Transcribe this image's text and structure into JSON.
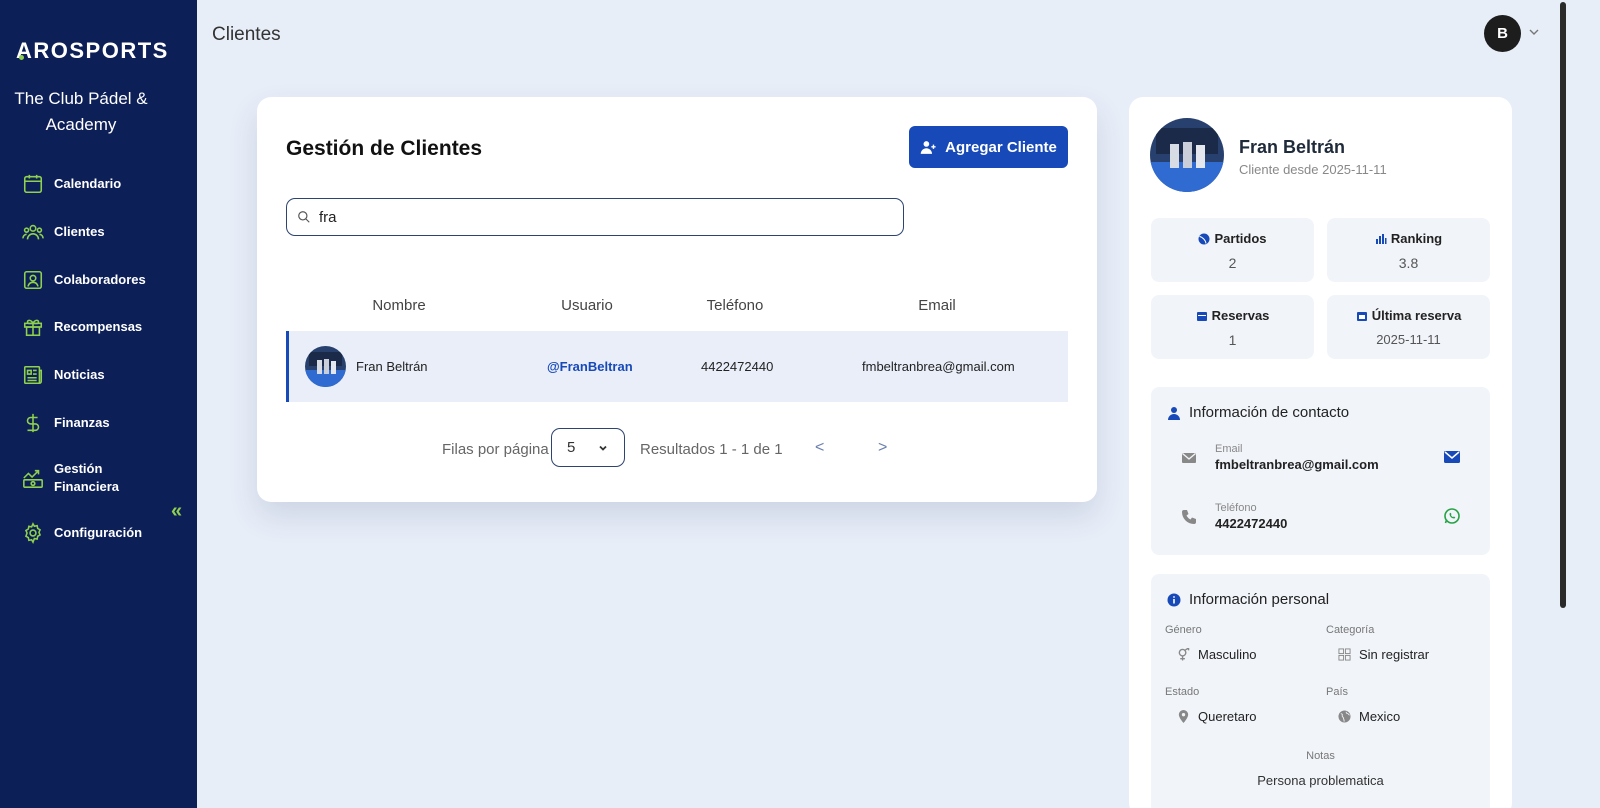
{
  "app": {
    "logo": "AROSPORTS",
    "club_name": "The Club Pádel & Academy"
  },
  "sidebar": {
    "items": [
      {
        "label": "Calendario",
        "icon": "calendar-icon"
      },
      {
        "label": "Clientes",
        "icon": "users-icon"
      },
      {
        "label": "Colaboradores",
        "icon": "id-badge-icon"
      },
      {
        "label": "Recompensas",
        "icon": "gift-icon"
      },
      {
        "label": "Noticias",
        "icon": "newspaper-icon"
      },
      {
        "label": "Finanzas",
        "icon": "dollar-icon"
      },
      {
        "label": "Gestión Financiera",
        "icon": "finance-chart-icon"
      },
      {
        "label": "Configuración",
        "icon": "gear-icon"
      }
    ],
    "collapse_glyph": "«"
  },
  "header": {
    "title": "Clientes",
    "avatar_initial": "B"
  },
  "clients": {
    "title": "Gestión de Clientes",
    "add_button": "Agregar Cliente",
    "search_value": "fra",
    "columns": [
      "Nombre",
      "Usuario",
      "Teléfono",
      "Email"
    ],
    "rows": [
      {
        "name": "Fran Beltrán",
        "username": "@FranBeltran",
        "phone": "4422472440",
        "email": "fmbeltranbrea@gmail.com"
      }
    ],
    "pagination": {
      "rows_label": "Filas por página",
      "rows_value": "5",
      "results": "Resultados 1 - 1 de 1",
      "prev": "<",
      "next": ">"
    }
  },
  "profile": {
    "name": "Fran Beltrán",
    "since": "Cliente desde 2025-11-11",
    "stats": [
      {
        "label": "Partidos",
        "value": "2"
      },
      {
        "label": "Ranking",
        "value": "3.8"
      },
      {
        "label": "Reservas",
        "value": "1"
      },
      {
        "label": "Última reserva",
        "value": "2025-11-11"
      }
    ],
    "contact": {
      "title": "Información de contacto",
      "email_label": "Email",
      "email": "fmbeltranbrea@gmail.com",
      "phone_label": "Teléfono",
      "phone": "4422472440"
    },
    "personal": {
      "title": "Información personal",
      "gender_label": "Género",
      "gender": "Masculino",
      "category_label": "Categoría",
      "category": "Sin registrar",
      "state_label": "Estado",
      "state": "Queretaro",
      "country_label": "País",
      "country": "Mexico",
      "notes_label": "Notas",
      "notes": "Persona problematica"
    }
  },
  "colors": {
    "sidebar_bg": "#0c1f57",
    "accent_green": "#8fd14f",
    "primary_blue": "#1749b8",
    "page_bg": "#e8eef8",
    "whatsapp_green": "#25a244"
  }
}
